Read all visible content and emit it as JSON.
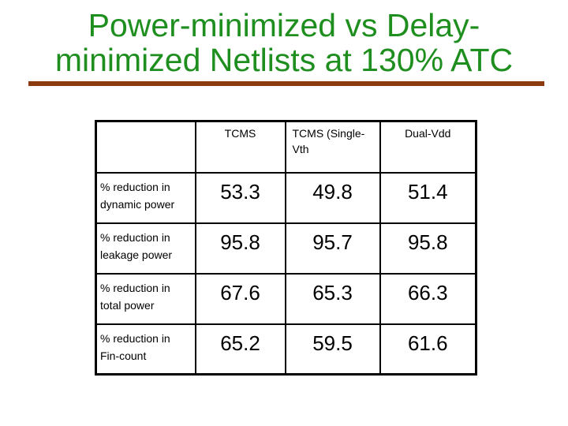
{
  "title": {
    "line1": "Power-minimized vs Delay-",
    "line2": "minimized Netlists at 130% ATC"
  },
  "colors": {
    "title": "#1e8f1e",
    "rule": "#8b3a10"
  },
  "table": {
    "headers": [
      "",
      "TCMS",
      "TCMS (Single-Vth",
      "Dual-Vdd"
    ],
    "rows": [
      {
        "label": "% reduction in dynamic power",
        "values": [
          "53.3",
          "49.8",
          "51.4"
        ]
      },
      {
        "label": "% reduction in leakage power",
        "values": [
          "95.8",
          "95.7",
          "95.8"
        ]
      },
      {
        "label": "% reduction in total power",
        "values": [
          "67.6",
          "65.3",
          "66.3"
        ]
      },
      {
        "label": "% reduction in Fin-count",
        "values": [
          "65.2",
          "59.5",
          "61.6"
        ]
      }
    ]
  }
}
